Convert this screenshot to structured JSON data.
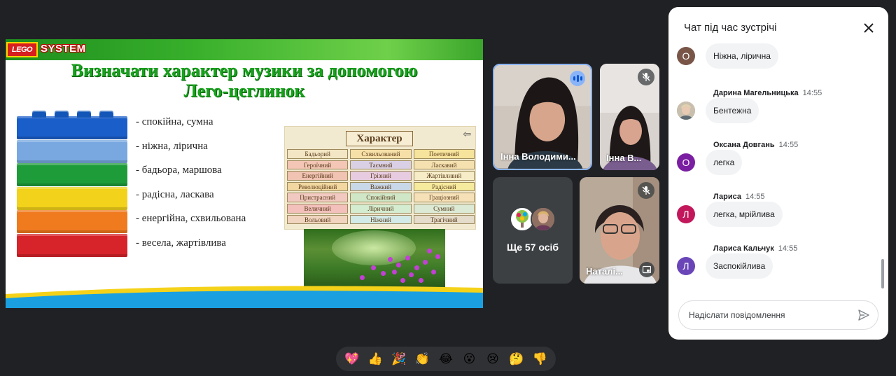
{
  "slide": {
    "lego_logo": "LEGO",
    "system_logo": "SYSTEM",
    "title_line1": "Визначати характер музики за допомогою",
    "title_line2": "Лего-цеглинок",
    "brick_colors": [
      "#1a5ec9",
      "#78a8df",
      "#1f9c3a",
      "#f2d21a",
      "#f07a1e",
      "#d6242a"
    ],
    "characteristics": [
      "- спокійна, сумна",
      "- ніжна, лірична",
      "- бадьора, маршова",
      "- радісна, ласкава",
      "- енергійна, схвильована",
      "- весела, жартівлива"
    ],
    "table_header": "Характер",
    "table_cells": [
      {
        "text": "Бадьорий",
        "bg": "#f3e6c4"
      },
      {
        "text": "Схвильований",
        "bg": "#f7e0a8"
      },
      {
        "text": "Поетичний",
        "bg": "#f6e39c"
      },
      {
        "text": "Героїчний",
        "bg": "#f3c6b5"
      },
      {
        "text": "Таємний",
        "bg": "#d9d0e6"
      },
      {
        "text": "Ласкавий",
        "bg": "#f5e0b0"
      },
      {
        "text": "Енергійний",
        "bg": "#f0c3b3"
      },
      {
        "text": "Грізний",
        "bg": "#e7cbe0"
      },
      {
        "text": "Жартівливий",
        "bg": "#f6edc8"
      },
      {
        "text": "Революційний",
        "bg": "#f2d7a0"
      },
      {
        "text": "Важкий",
        "bg": "#c9d8e8"
      },
      {
        "text": "Радісний",
        "bg": "#f6ea9e"
      },
      {
        "text": "Пристрасний",
        "bg": "#f2c9c0"
      },
      {
        "text": "Спокійний",
        "bg": "#cfe6c7"
      },
      {
        "text": "Граціозний",
        "bg": "#f6e0b8"
      },
      {
        "text": "Величний",
        "bg": "#f3c0bc"
      },
      {
        "text": "Ліричний",
        "bg": "#d4ecd0"
      },
      {
        "text": "Сумний",
        "bg": "#dcead5"
      },
      {
        "text": "Вольовий",
        "bg": "#f1d5c0"
      },
      {
        "text": "Ніжний",
        "bg": "#d3ebe8"
      },
      {
        "text": "Трагічний",
        "bg": "#e5dccb"
      }
    ]
  },
  "participants": {
    "tile1_name": "Інна Володими...",
    "tile2_name": "Інна В...",
    "tile3_label": "Ще 57 осіб",
    "tile4_name": "Наталі..."
  },
  "chat": {
    "title": "Чат під час зустрічі",
    "messages": [
      {
        "sender": "",
        "time": "",
        "initial": "О",
        "avatar_color": "#795548",
        "text": "Ніжна, лірична"
      },
      {
        "sender": "Дарина Магельницька",
        "time": "14:55",
        "initial": "",
        "avatar_color": "#b0a48a",
        "text": "Бентежна"
      },
      {
        "sender": "Оксана Довгань",
        "time": "14:55",
        "initial": "О",
        "avatar_color": "#7b1fa2",
        "text": "легка"
      },
      {
        "sender": "Лариса",
        "time": "14:55",
        "initial": "Л",
        "avatar_color": "#c2185b",
        "text": "легка, мрійлива"
      },
      {
        "sender": "Лариса Кальчук",
        "time": "14:55",
        "initial": "Л",
        "avatar_color": "#6a45b8",
        "text": "Заспокійлива"
      }
    ],
    "input_placeholder": "Надіслати повідомлення"
  },
  "reactions": [
    "💖",
    "👍",
    "🎉",
    "👏",
    "😂",
    "😮",
    "😢",
    "🤔",
    "👎"
  ]
}
